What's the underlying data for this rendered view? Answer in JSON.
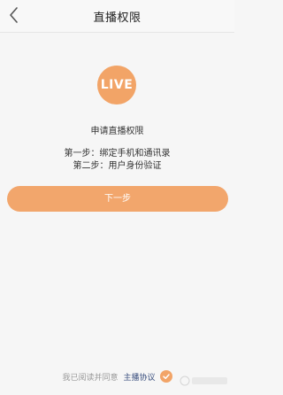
{
  "nav": {
    "title": "直播权限",
    "back_icon": "chevron-left-icon"
  },
  "badge": {
    "label": "LIVE",
    "color": "#f2a467"
  },
  "content": {
    "heading": "申请直播权限",
    "step1": "第一步：绑定手机和通讯录",
    "step2": "第二步：用户身份验证"
  },
  "actions": {
    "next_label": "下一步",
    "button_color": "#f2a66c"
  },
  "footer": {
    "agree_text": "我已阅读并同意",
    "link_text": "主播协议",
    "checkbox_icon": "check-circle-icon",
    "checked": true
  }
}
